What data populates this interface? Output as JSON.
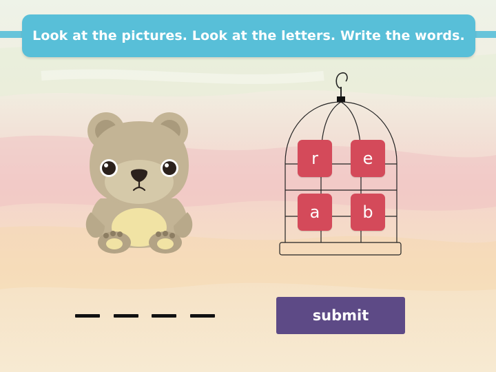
{
  "instruction": "Look at the pictures. Look at the letters.  Write the words.",
  "picture": {
    "icon": "bear"
  },
  "letters": [
    {
      "label": "r"
    },
    {
      "label": "e"
    },
    {
      "label": "a"
    },
    {
      "label": "b"
    }
  ],
  "answer_slots": [
    "",
    "",
    "",
    ""
  ],
  "submit_label": "submit",
  "colors": {
    "header": "#58bfd8",
    "tile": "#d44a5a",
    "submit": "#5d4a86",
    "bear_fur": "#c3b495",
    "bear_belly": "#f1e3a4"
  }
}
